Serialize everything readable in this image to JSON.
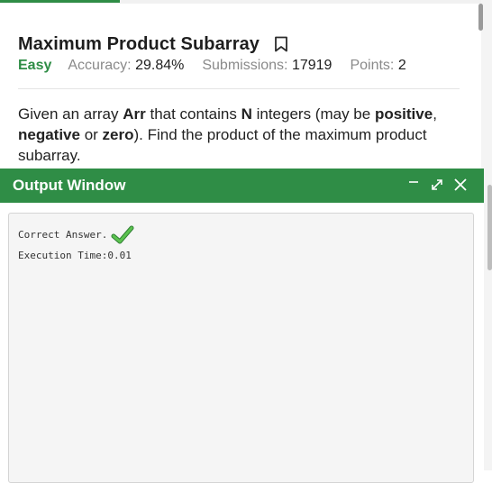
{
  "problem": {
    "title": "Maximum Product Subarray",
    "difficulty": "Easy",
    "accuracy_label": "Accuracy:",
    "accuracy_value": "29.84%",
    "submissions_label": "Submissions:",
    "submissions_value": "17919",
    "points_label": "Points:",
    "points_value": "2",
    "description": {
      "p1": "Given an array ",
      "arr": "Arr",
      "p2": " that contains ",
      "n": "N",
      "p3": " integers (may be ",
      "positive": "positive",
      "p4": ", ",
      "negative": "negative",
      "p5": " or ",
      "zero": "zero",
      "p6": "). Find the product of the maximum product subarray."
    }
  },
  "output_window": {
    "title": "Output Window",
    "result_text": "Correct Answer.",
    "execution_text": "Execution Time:0.01"
  },
  "colors": {
    "brand_green": "#2f8d46"
  },
  "icons": {
    "bookmark": "bookmark-icon",
    "minimize": "minimize-icon",
    "expand": "expand-icon",
    "close": "close-icon",
    "check": "checkmark-icon"
  }
}
